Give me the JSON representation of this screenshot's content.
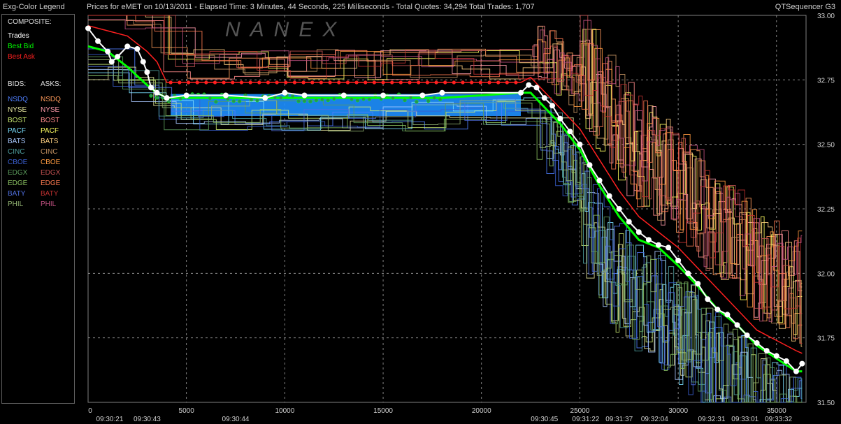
{
  "header": {
    "legend_title": "Exg-Color Legend",
    "chart_title": "Prices for  eMET  on  10/13/2011  -  Elapsed Time: 3 Minutes, 44 Seconds, 225 Milliseconds  -  Total Quotes: 34,294  Total Trades: 1,707",
    "app_name": "QTSequencer G3"
  },
  "legend": {
    "composite_label": "COMPOSITE:",
    "trades_label": "Trades",
    "best_bid_label": "Best Bid",
    "best_ask_label": "Best Ask",
    "bids_header": "BIDS:",
    "asks_header": "ASKS:",
    "exchanges": [
      {
        "bid": "NSDQ",
        "ask": "NSDQ",
        "bid_color": "#4f7fff",
        "ask_color": "#ff9a5a"
      },
      {
        "bid": "NYSE",
        "ask": "NYSE",
        "bid_color": "#e8e8a0",
        "ask_color": "#ff9aaa"
      },
      {
        "bid": "BOST",
        "ask": "BOST",
        "bid_color": "#c8e870",
        "ask_color": "#ff8a8a"
      },
      {
        "bid": "PACF",
        "ask": "PACF",
        "bid_color": "#7adfff",
        "ask_color": "#ffff60"
      },
      {
        "bid": "BATS",
        "ask": "BATS",
        "bid_color": "#a8c8ff",
        "ask_color": "#ffd080"
      },
      {
        "bid": "CINC",
        "ask": "CINC",
        "bid_color": "#4fa0a0",
        "ask_color": "#c09060"
      },
      {
        "bid": "CBOE",
        "ask": "CBOE",
        "bid_color": "#3a5fd0",
        "ask_color": "#ff9a40"
      },
      {
        "bid": "EDGX",
        "ask": "EDGX",
        "bid_color": "#5a9a5a",
        "ask_color": "#c05050"
      },
      {
        "bid": "EDGE",
        "ask": "EDGE",
        "bid_color": "#8ac060",
        "ask_color": "#ff7a50"
      },
      {
        "bid": "BATY",
        "ask": "BATY",
        "bid_color": "#5070e0",
        "ask_color": "#c03030"
      },
      {
        "bid": "PHIL",
        "ask": "PHIL",
        "bid_color": "#90b070",
        "ask_color": "#c05080"
      }
    ]
  },
  "watermark": "NANEX",
  "colors": {
    "trades": "#ffffff",
    "best_bid": "#00ff00",
    "best_ask": "#ff2020",
    "bid_band": "#1e90ff",
    "grid": "#a0a0a0"
  },
  "chart_data": {
    "type": "line",
    "ylim": [
      31.5,
      33.0
    ],
    "xlim": [
      0,
      36500
    ],
    "y_ticks": [
      "33.00",
      "32.75",
      "32.50",
      "32.25",
      "32.00",
      "31.75",
      "31.50"
    ],
    "y_tick_values": [
      33.0,
      32.75,
      32.5,
      32.25,
      32.0,
      31.75,
      31.5
    ],
    "x_ticks": [
      "0",
      "5000",
      "10000",
      "15000",
      "20000",
      "25000",
      "30000",
      "35000"
    ],
    "x_tick_values": [
      0,
      5000,
      10000,
      15000,
      20000,
      25000,
      30000,
      35000
    ],
    "time_labels": [
      {
        "label": "09:30:21",
        "x": 1100
      },
      {
        "label": "09:30:43",
        "x": 3000
      },
      {
        "label": "09:30:44",
        "x": 7500
      },
      {
        "label": "09:30:45",
        "x": 23200
      },
      {
        "label": "09:31:22",
        "x": 25300
      },
      {
        "label": "09:31:37",
        "x": 27000
      },
      {
        "label": "09:32:04",
        "x": 28800
      },
      {
        "label": "09:32:31",
        "x": 31700
      },
      {
        "label": "09:33:01",
        "x": 33400
      },
      {
        "label": "09:33:32",
        "x": 35100
      }
    ],
    "series": [
      {
        "role": "trades",
        "x": [
          0,
          500,
          1000,
          1200,
          1500,
          2000,
          2500,
          2800,
          3000,
          3200,
          3500,
          4000,
          5000,
          7000,
          9000,
          10000,
          11000,
          13000,
          15000,
          17000,
          18000,
          22000,
          22400,
          22800,
          23200,
          23600,
          24000,
          24500,
          25000,
          25500,
          26000,
          26500,
          27000,
          27500,
          28000,
          28500,
          29000,
          29500,
          30000,
          30500,
          31000,
          31500,
          32000,
          32500,
          33000,
          33500,
          34000,
          34500,
          35000,
          35500,
          36000,
          36300
        ],
        "y": [
          32.95,
          32.9,
          32.86,
          32.82,
          32.84,
          32.88,
          32.87,
          32.82,
          32.78,
          32.72,
          32.7,
          32.68,
          32.69,
          32.69,
          32.68,
          32.7,
          32.69,
          32.69,
          32.69,
          32.69,
          32.7,
          32.7,
          32.73,
          32.72,
          32.68,
          32.65,
          32.6,
          32.55,
          32.5,
          32.42,
          32.36,
          32.3,
          32.25,
          32.2,
          32.16,
          32.13,
          32.11,
          32.1,
          32.05,
          32.0,
          31.96,
          31.9,
          31.86,
          31.84,
          31.8,
          31.76,
          31.73,
          31.7,
          31.68,
          31.66,
          31.62,
          31.65
        ]
      },
      {
        "role": "best_bid",
        "x": [
          0,
          1000,
          2000,
          3000,
          3500,
          4000,
          6000,
          9000,
          12000,
          15000,
          18000,
          22000,
          22500,
          23000,
          24000,
          25000,
          26000,
          27000,
          28000,
          29000,
          30000,
          31000,
          32000,
          33000,
          34000,
          35000,
          36000,
          36300
        ],
        "y": [
          32.88,
          32.86,
          32.8,
          32.73,
          32.7,
          32.68,
          32.68,
          32.68,
          32.68,
          32.68,
          32.68,
          32.7,
          32.7,
          32.66,
          32.58,
          32.48,
          32.34,
          32.22,
          32.13,
          32.1,
          32.03,
          31.95,
          31.86,
          31.8,
          31.72,
          31.67,
          31.62,
          31.62
        ]
      },
      {
        "role": "best_ask",
        "x": [
          0,
          1000,
          2000,
          3000,
          3500,
          4000,
          6000,
          9000,
          12000,
          15000,
          18000,
          22000,
          22500,
          23000,
          24000,
          25000,
          26000,
          27000,
          28000,
          29000,
          30000,
          31000,
          32000,
          33000,
          34000,
          35000,
          36000,
          36300
        ],
        "y": [
          32.96,
          32.94,
          32.92,
          32.86,
          32.82,
          32.74,
          32.74,
          32.74,
          32.74,
          32.74,
          32.74,
          32.74,
          32.76,
          32.72,
          32.64,
          32.56,
          32.44,
          32.32,
          32.22,
          32.16,
          32.1,
          32.02,
          31.94,
          31.86,
          31.78,
          31.74,
          31.7,
          31.69
        ]
      }
    ]
  }
}
